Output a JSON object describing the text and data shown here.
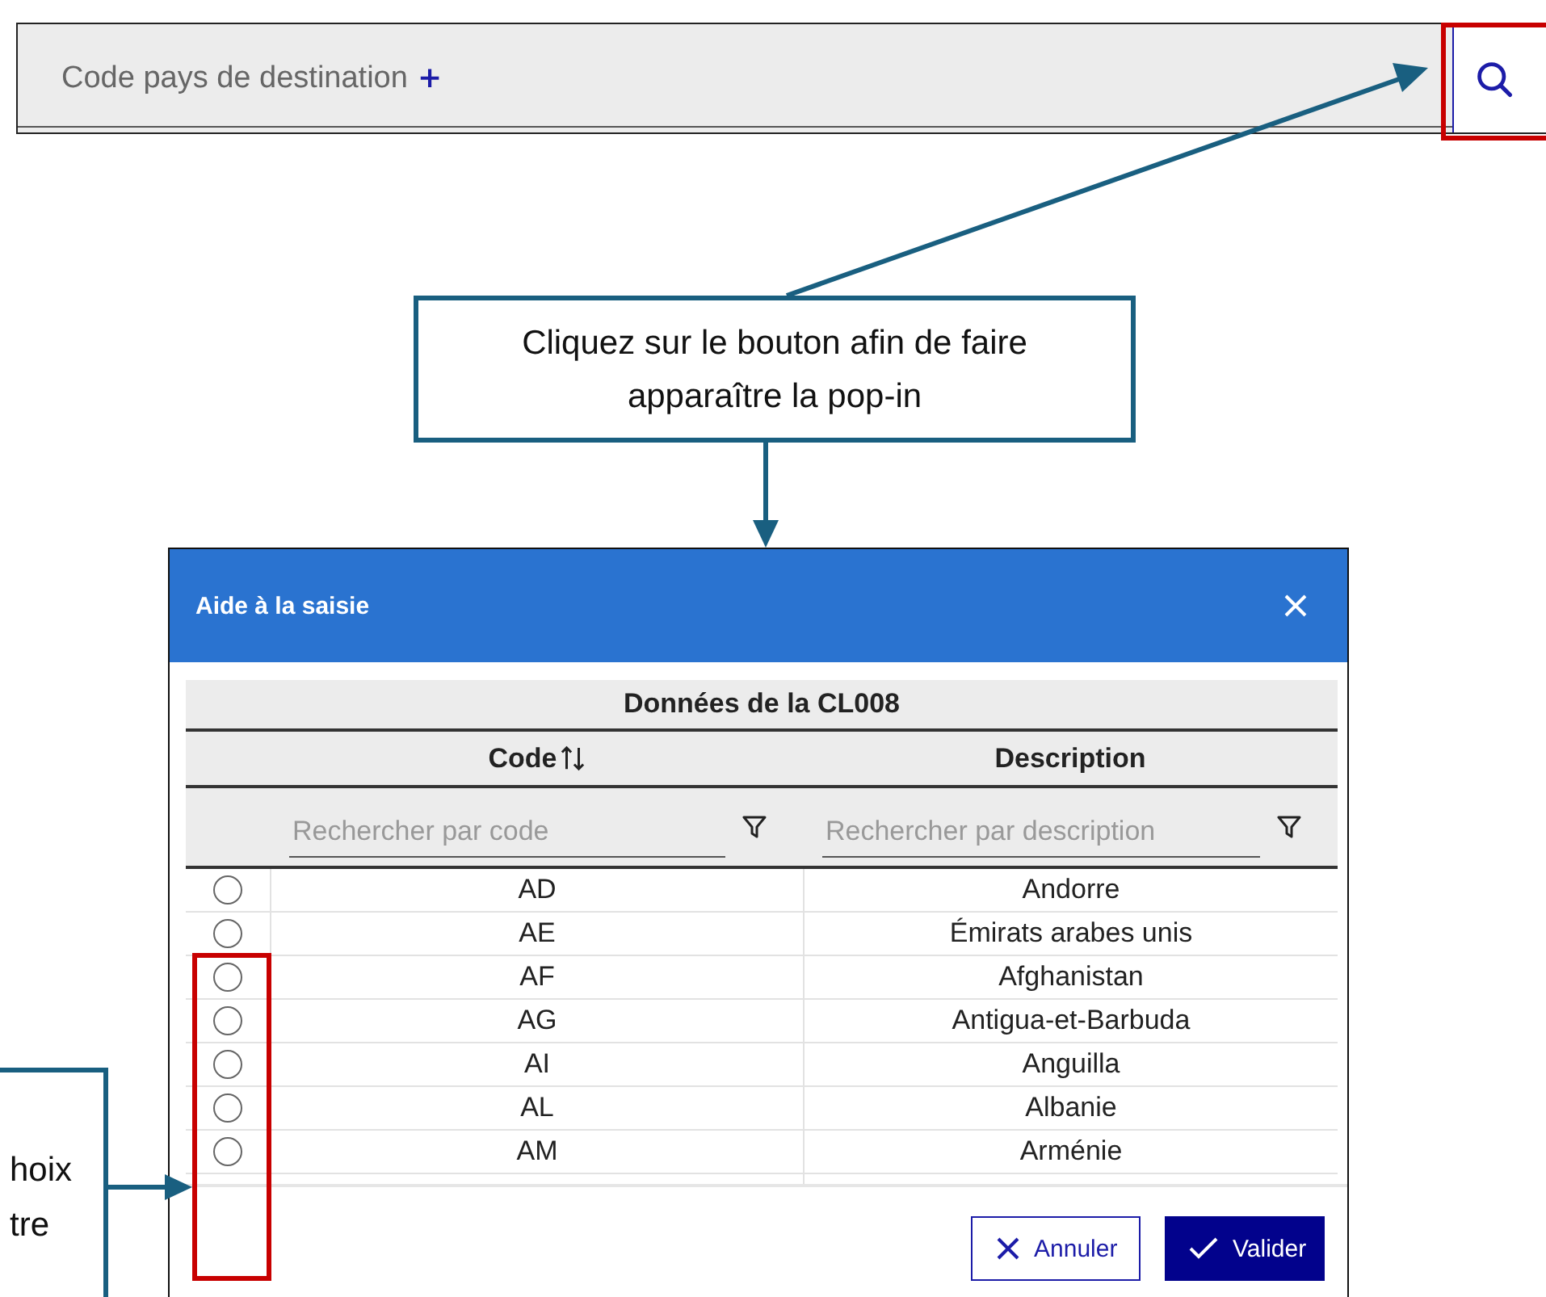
{
  "field": {
    "label": "Code pays de destination",
    "required_mark": "+"
  },
  "top_callout": {
    "text": "Cliquez sur le bouton afin de faire apparaître la pop-in"
  },
  "left_callout": {
    "lines": [
      "hoix",
      "tre"
    ]
  },
  "dialog": {
    "title": "Aide à la saisie",
    "table": {
      "caption": "Données de la CL008",
      "columns": [
        {
          "label": "Code",
          "sortable": true,
          "filter_placeholder": "Rechercher par code"
        },
        {
          "label": "Description",
          "sortable": false,
          "filter_placeholder": "Rechercher par description"
        }
      ],
      "rows": [
        {
          "code": "AD",
          "description": "Andorre",
          "selected": false
        },
        {
          "code": "AE",
          "description": "Émirats arabes unis",
          "selected": false
        },
        {
          "code": "AF",
          "description": "Afghanistan",
          "selected": false
        },
        {
          "code": "AG",
          "description": "Antigua-et-Barbuda",
          "selected": false
        },
        {
          "code": "AI",
          "description": "Anguilla",
          "selected": false
        },
        {
          "code": "AL",
          "description": "Albanie",
          "selected": false
        },
        {
          "code": "AM",
          "description": "Arménie",
          "selected": false
        }
      ]
    },
    "buttons": [
      {
        "label": "Annuler",
        "kind": "secondary"
      },
      {
        "label": "Valider",
        "kind": "primary"
      }
    ]
  }
}
